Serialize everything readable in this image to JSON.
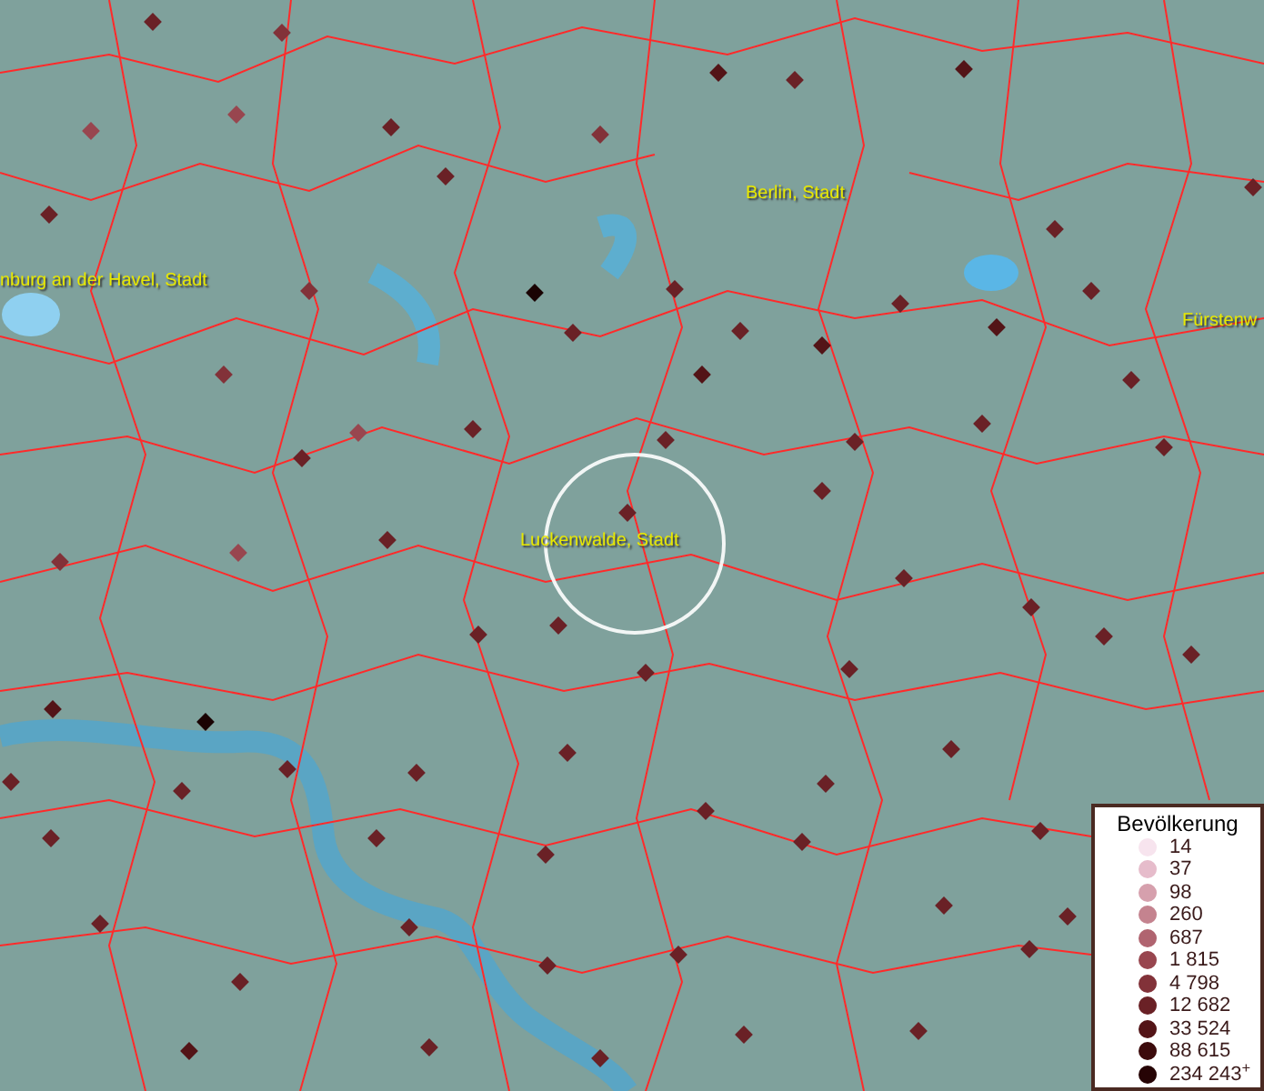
{
  "map": {
    "place_labels": [
      {
        "text": "Berlin, Stadt"
      },
      {
        "text": "nburg an der Havel, Stadt"
      },
      {
        "text": "Fürstenw"
      },
      {
        "text": "Luckenwalde, Stadt",
        "selected": true
      }
    ]
  },
  "legend": {
    "title": "Bevölkerung",
    "items": [
      {
        "label": "14",
        "color": "#f7e4ee"
      },
      {
        "label": "37",
        "color": "#e6bccb"
      },
      {
        "label": "98",
        "color": "#d6a0ad"
      },
      {
        "label": "260",
        "color": "#c4838f"
      },
      {
        "label": "687",
        "color": "#b06470"
      },
      {
        "label": "1 815",
        "color": "#98464f"
      },
      {
        "label": "4 798",
        "color": "#823239"
      },
      {
        "label": "12 682",
        "color": "#6a2126"
      },
      {
        "label": "33 524",
        "color": "#531417"
      },
      {
        "label": "88 615",
        "color": "#3c0b0c"
      },
      {
        "label": "234 243$^{+}$",
        "color": "#260405"
      }
    ]
  }
}
